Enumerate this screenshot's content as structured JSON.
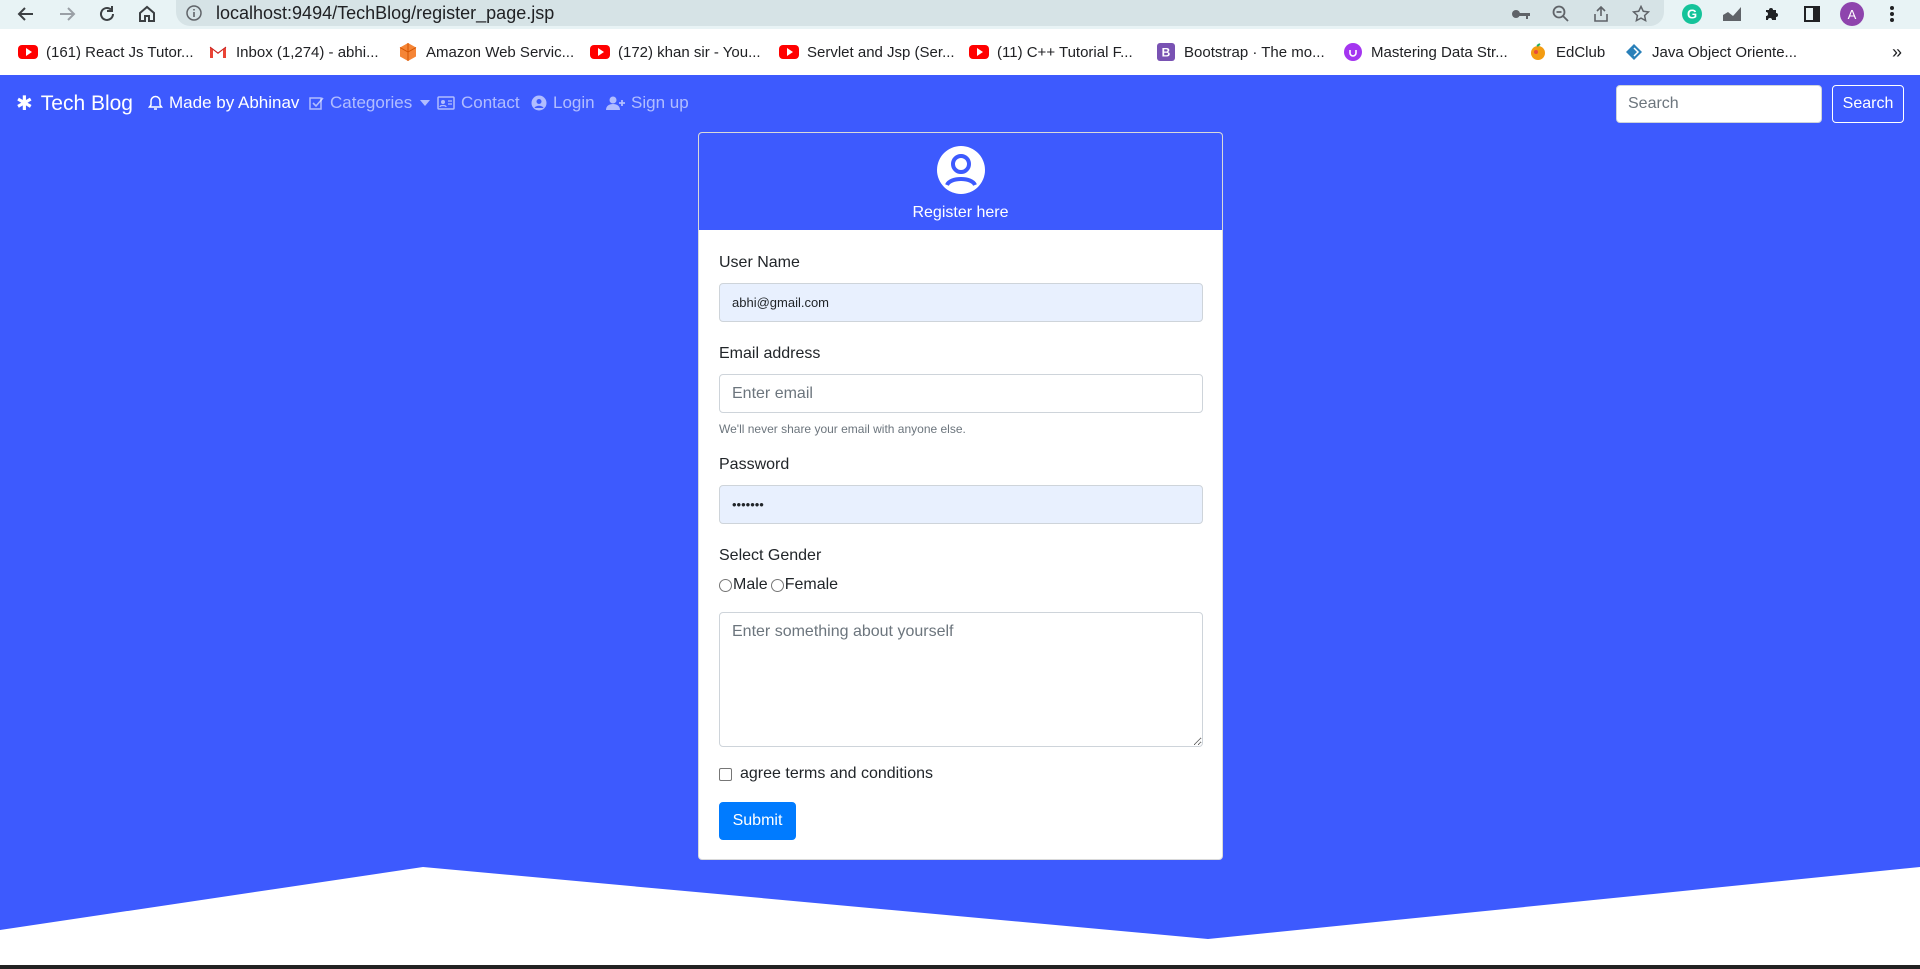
{
  "browser": {
    "url": "localhost:9494/TechBlog/register_page.jsp",
    "profile_initial": "A",
    "bookmarks": [
      {
        "label": "(161) React Js Tutor...",
        "icon": "youtube-icon"
      },
      {
        "label": "Inbox (1,274) - abhi...",
        "icon": "gmail-icon"
      },
      {
        "label": "Amazon Web Servic...",
        "icon": "aws-icon"
      },
      {
        "label": "(172) khan sir - You...",
        "icon": "youtube-icon"
      },
      {
        "label": "Servlet and Jsp (Ser...",
        "icon": "youtube-icon"
      },
      {
        "label": "(11) C++ Tutorial F...",
        "icon": "youtube-icon"
      },
      {
        "label": "Bootstrap · The mo...",
        "icon": "bootstrap-icon"
      },
      {
        "label": "Mastering Data Str...",
        "icon": "udemy-icon"
      },
      {
        "label": "EdClub",
        "icon": "edclub-icon"
      },
      {
        "label": "Java Object Oriente...",
        "icon": "java-icon"
      }
    ],
    "more_label": "»"
  },
  "navbar": {
    "brand": "Tech Blog",
    "items": [
      {
        "label": "Made by Abhinav",
        "icon": "bell-icon"
      },
      {
        "label": "Categories",
        "icon": "check-square-icon"
      },
      {
        "label": "Contact",
        "icon": "address-card-icon"
      },
      {
        "label": "Login",
        "icon": "user-circle-icon"
      },
      {
        "label": "Sign up",
        "icon": "user-plus-icon"
      }
    ],
    "search_placeholder": "Search",
    "search_button": "Search"
  },
  "form": {
    "header_title": "Register here",
    "username_label": "User Name",
    "username_value": "abhi@gmail.com",
    "email_label": "Email address",
    "email_placeholder": "Enter email",
    "email_help": "We'll never share your email with anyone else.",
    "password_label": "Password",
    "password_value": "•••••••",
    "gender_label": "Select Gender",
    "gender_male": "Male",
    "gender_female": "Female",
    "about_placeholder": "Enter something about yourself",
    "terms_label": "agree terms and conditions",
    "submit_label": "Submit"
  },
  "colors": {
    "primary": "#3d5afe",
    "button": "#007bff",
    "autofill": "#e8f0fe"
  }
}
